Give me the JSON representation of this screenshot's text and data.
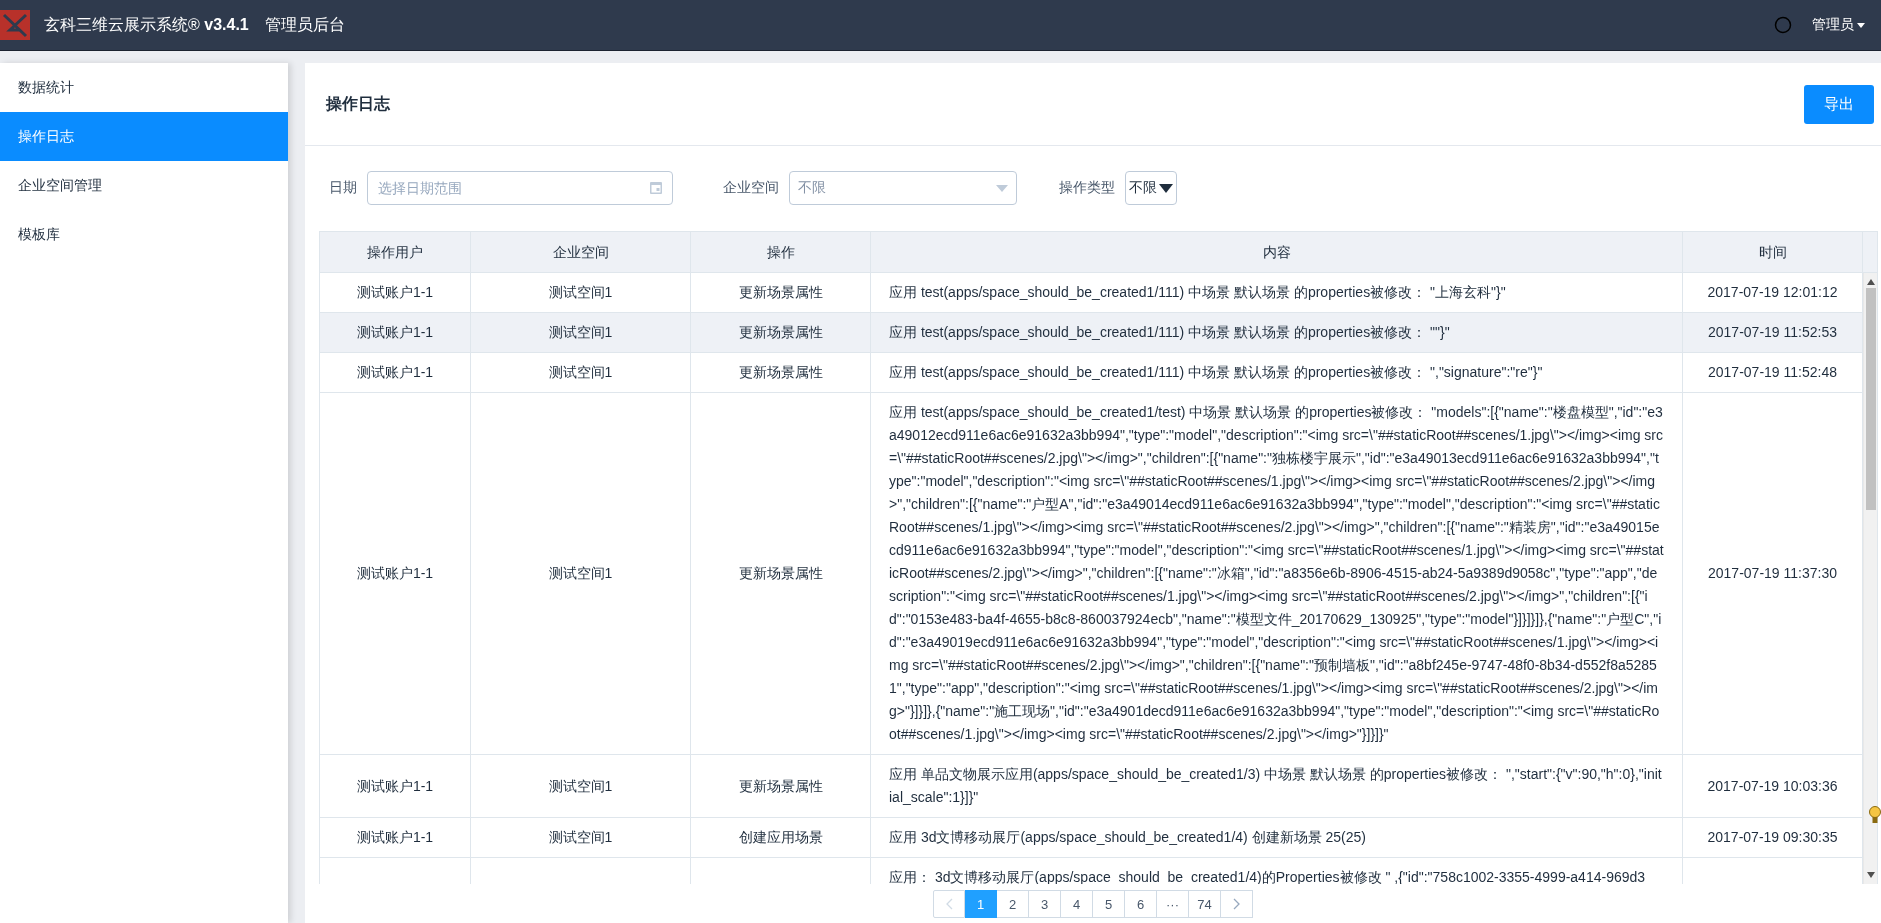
{
  "header": {
    "title": "玄科三维云展示系统® **v3.4.1**",
    "subtitle": "管理员后台",
    "user": "管理员"
  },
  "sidebar": {
    "items": [
      {
        "label": "数据统计",
        "selected": false
      },
      {
        "label": "操作日志",
        "selected": true
      },
      {
        "label": "企业空间管理",
        "selected": false
      },
      {
        "label": "模板库",
        "selected": false
      }
    ]
  },
  "page": {
    "title": "操作日志",
    "export_button": "导出"
  },
  "filters": [
    {
      "kind": "date",
      "label": "日期",
      "placeholder": "选择日期范围"
    },
    {
      "kind": "select",
      "label": "企业空间",
      "value": "不限"
    },
    {
      "kind": "compact-select",
      "label": "操作类型",
      "value": "不限"
    }
  ],
  "table": {
    "columns": [
      "操作用户",
      "企业空间",
      "操作",
      "内容",
      "时间"
    ],
    "rows": [
      {
        "user": "测试账户1-1",
        "space": "测试空间1",
        "action": "更新场景属性",
        "content": "应用 test(apps/space_should_be_created1/111) 中场景 默认场景 的properties被修改： \"上海玄科\"}\"",
        "time": "2017-07-19 12:01:12",
        "selected": false
      },
      {
        "user": "测试账户1-1",
        "space": "测试空间1",
        "action": "更新场景属性",
        "content": "应用 test(apps/space_should_be_created1/111) 中场景 默认场景 的properties被修改： \"\"}\"",
        "time": "2017-07-19 11:52:53",
        "selected": true
      },
      {
        "user": "测试账户1-1",
        "space": "测试空间1",
        "action": "更新场景属性",
        "content": "应用 test(apps/space_should_be_created1/111) 中场景 默认场景 的properties被修改： \",\"signature\":\"re\"}\"",
        "time": "2017-07-19 11:52:48",
        "selected": false
      },
      {
        "user": "测试账户1-1",
        "space": "测试空间1",
        "action": "更新场景属性",
        "content": "应用 test(apps/space_should_be_created1/test) 中场景 默认场景 的properties被修改： \"models\":[{\"name\":\"楼盘模型\",\"id\":\"e3a49012ecd911e6ac6e91632a3bb994\",\"type\":\"model\",\"description\":\"<img src=\\\"##staticRoot##scenes/1.jpg\\\"></img><img src=\\\"##staticRoot##scenes/2.jpg\\\"></img>\",\"children\":[{\"name\":\"独栋楼宇展示\",\"id\":\"e3a49013ecd911e6ac6e91632a3bb994\",\"type\":\"model\",\"description\":\"<img src=\\\"##staticRoot##scenes/1.jpg\\\"></img><img src=\\\"##staticRoot##scenes/2.jpg\\\"></img>\",\"children\":[{\"name\":\"户型A\",\"id\":\"e3a49014ecd911e6ac6e91632a3bb994\",\"type\":\"model\",\"description\":\"<img src=\\\"##staticRoot##scenes/1.jpg\\\"></img><img src=\\\"##staticRoot##scenes/2.jpg\\\"></img>\",\"children\":[{\"name\":\"精装房\",\"id\":\"e3a49015ecd911e6ac6e91632a3bb994\",\"type\":\"model\",\"description\":\"<img src=\\\"##staticRoot##scenes/1.jpg\\\"></img><img src=\\\"##staticRoot##scenes/2.jpg\\\"></img>\",\"children\":[{\"name\":\"冰箱\",\"id\":\"a8356e6b-8906-4515-ab24-5a9389d9058c\",\"type\":\"app\",\"description\":\"<img src=\\\"##staticRoot##scenes/1.jpg\\\"></img><img src=\\\"##staticRoot##scenes/2.jpg\\\"></img>\",\"children\":[{\"id\":\"0153e483-ba4f-4655-b8c8-860037924ecb\",\"name\":\"模型文件_20170629_130925\",\"type\":\"model\"}]}]}]},{\"name\":\"户型C\",\"id\":\"e3a49019ecd911e6ac6e91632a3bb994\",\"type\":\"model\",\"description\":\"<img src=\\\"##staticRoot##scenes/1.jpg\\\"></img><img src=\\\"##staticRoot##scenes/2.jpg\\\"></img>\",\"children\":[{\"name\":\"预制墙板\",\"id\":\"a8bf245e-9747-48f0-8b34-d552f8a52851\",\"type\":\"app\",\"description\":\"<img src=\\\"##staticRoot##scenes/1.jpg\\\"></img><img src=\\\"##staticRoot##scenes/2.jpg\\\"></img>\"}]}]},{\"name\":\"施工现场\",\"id\":\"e3a4901decd911e6ac6e91632a3bb994\",\"type\":\"model\",\"description\":\"<img src=\\\"##staticRoot##scenes/1.jpg\\\"></img><img src=\\\"##staticRoot##scenes/2.jpg\\\"></img>\"}]}]}\"",
        "time": "2017-07-19 11:37:30",
        "selected": false
      },
      {
        "user": "测试账户1-1",
        "space": "测试空间1",
        "action": "更新场景属性",
        "content": "应用 单品文物展示应用(apps/space_should_be_created1/3) 中场景 默认场景 的properties被修改： \",\"start\":{\"v\":90,\"h\":0},\"initial_scale\":1}]}\"",
        "time": "2017-07-19 10:03:36",
        "selected": false
      },
      {
        "user": "测试账户1-1",
        "space": "测试空间1",
        "action": "创建应用场景",
        "content": "应用 3d文博移动展厅(apps/space_should_be_created1/4) 创建新场景 25(25)",
        "time": "2017-07-19 09:30:35",
        "selected": false
      },
      {
        "content": "应用：  3d文博移动展厅(apps/space_should_be_created1/4)的Properties被修改 \" ,{\"id\":\"758c1002-3355-4999-a414-969d3",
        "selected": false
      }
    ]
  },
  "pagination": {
    "prev": {
      "disabled": true
    },
    "next": {
      "disabled": false
    },
    "pages": [
      {
        "label": "1",
        "selected": true
      },
      {
        "label": "2",
        "selected": false
      },
      {
        "label": "3",
        "selected": false
      },
      {
        "label": "4",
        "selected": false
      },
      {
        "label": "5",
        "selected": false
      },
      {
        "label": "6",
        "selected": false
      },
      {
        "label": "···",
        "selected": false
      },
      {
        "label": "74",
        "selected": false
      }
    ]
  }
}
